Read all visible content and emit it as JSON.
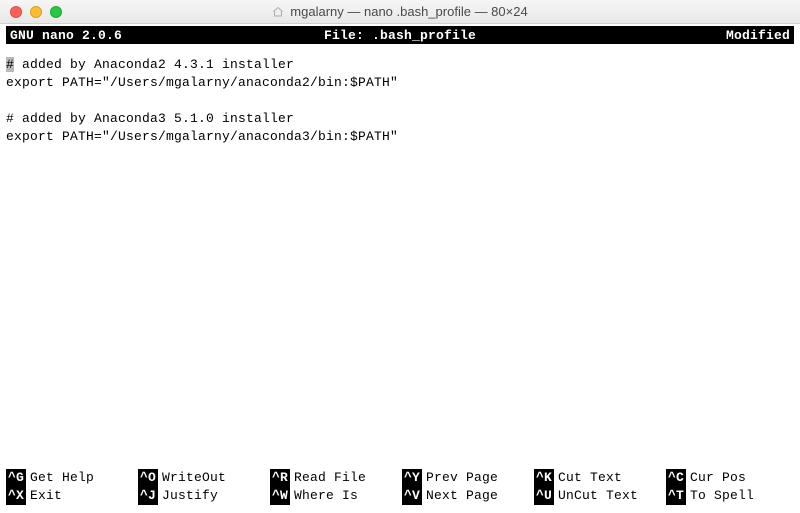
{
  "window": {
    "title": "mgalarny — nano .bash_profile — 80×24"
  },
  "nano": {
    "app": "GNU nano 2.0.6",
    "file_label": "File: .bash_profile",
    "modified": "Modified"
  },
  "file": {
    "lines": [
      "# added by Anaconda2 4.3.1 installer",
      "export PATH=\"/Users/mgalarny/anaconda2/bin:$PATH\"",
      "",
      "# added by Anaconda3 5.1.0 installer",
      "export PATH=\"/Users/mgalarny/anaconda3/bin:$PATH\""
    ],
    "cursor_line": 0,
    "cursor_col": 0
  },
  "help": [
    {
      "key": "^G",
      "label": "Get Help"
    },
    {
      "key": "^O",
      "label": "WriteOut"
    },
    {
      "key": "^R",
      "label": "Read File"
    },
    {
      "key": "^Y",
      "label": "Prev Page"
    },
    {
      "key": "^K",
      "label": "Cut Text"
    },
    {
      "key": "^C",
      "label": "Cur Pos"
    },
    {
      "key": "^X",
      "label": "Exit"
    },
    {
      "key": "^J",
      "label": "Justify"
    },
    {
      "key": "^W",
      "label": "Where Is"
    },
    {
      "key": "^V",
      "label": "Next Page"
    },
    {
      "key": "^U",
      "label": "UnCut Text"
    },
    {
      "key": "^T",
      "label": "To Spell"
    }
  ]
}
